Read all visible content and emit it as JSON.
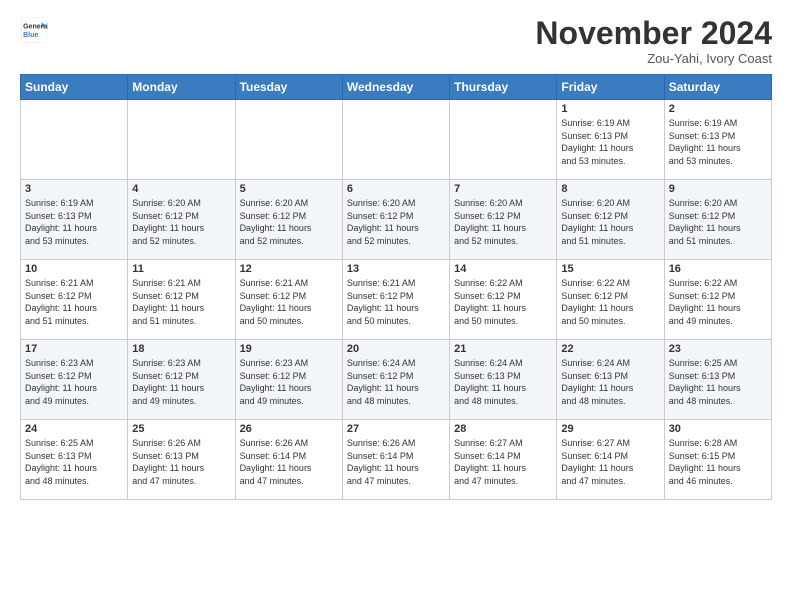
{
  "logo": {
    "line1": "General",
    "line2": "Blue"
  },
  "title": "November 2024",
  "location": "Zou-Yahi, Ivory Coast",
  "weekdays": [
    "Sunday",
    "Monday",
    "Tuesday",
    "Wednesday",
    "Thursday",
    "Friday",
    "Saturday"
  ],
  "weeks": [
    [
      {
        "day": "",
        "info": ""
      },
      {
        "day": "",
        "info": ""
      },
      {
        "day": "",
        "info": ""
      },
      {
        "day": "",
        "info": ""
      },
      {
        "day": "",
        "info": ""
      },
      {
        "day": "1",
        "info": "Sunrise: 6:19 AM\nSunset: 6:13 PM\nDaylight: 11 hours\nand 53 minutes."
      },
      {
        "day": "2",
        "info": "Sunrise: 6:19 AM\nSunset: 6:13 PM\nDaylight: 11 hours\nand 53 minutes."
      }
    ],
    [
      {
        "day": "3",
        "info": "Sunrise: 6:19 AM\nSunset: 6:13 PM\nDaylight: 11 hours\nand 53 minutes."
      },
      {
        "day": "4",
        "info": "Sunrise: 6:20 AM\nSunset: 6:12 PM\nDaylight: 11 hours\nand 52 minutes."
      },
      {
        "day": "5",
        "info": "Sunrise: 6:20 AM\nSunset: 6:12 PM\nDaylight: 11 hours\nand 52 minutes."
      },
      {
        "day": "6",
        "info": "Sunrise: 6:20 AM\nSunset: 6:12 PM\nDaylight: 11 hours\nand 52 minutes."
      },
      {
        "day": "7",
        "info": "Sunrise: 6:20 AM\nSunset: 6:12 PM\nDaylight: 11 hours\nand 52 minutes."
      },
      {
        "day": "8",
        "info": "Sunrise: 6:20 AM\nSunset: 6:12 PM\nDaylight: 11 hours\nand 51 minutes."
      },
      {
        "day": "9",
        "info": "Sunrise: 6:20 AM\nSunset: 6:12 PM\nDaylight: 11 hours\nand 51 minutes."
      }
    ],
    [
      {
        "day": "10",
        "info": "Sunrise: 6:21 AM\nSunset: 6:12 PM\nDaylight: 11 hours\nand 51 minutes."
      },
      {
        "day": "11",
        "info": "Sunrise: 6:21 AM\nSunset: 6:12 PM\nDaylight: 11 hours\nand 51 minutes."
      },
      {
        "day": "12",
        "info": "Sunrise: 6:21 AM\nSunset: 6:12 PM\nDaylight: 11 hours\nand 50 minutes."
      },
      {
        "day": "13",
        "info": "Sunrise: 6:21 AM\nSunset: 6:12 PM\nDaylight: 11 hours\nand 50 minutes."
      },
      {
        "day": "14",
        "info": "Sunrise: 6:22 AM\nSunset: 6:12 PM\nDaylight: 11 hours\nand 50 minutes."
      },
      {
        "day": "15",
        "info": "Sunrise: 6:22 AM\nSunset: 6:12 PM\nDaylight: 11 hours\nand 50 minutes."
      },
      {
        "day": "16",
        "info": "Sunrise: 6:22 AM\nSunset: 6:12 PM\nDaylight: 11 hours\nand 49 minutes."
      }
    ],
    [
      {
        "day": "17",
        "info": "Sunrise: 6:23 AM\nSunset: 6:12 PM\nDaylight: 11 hours\nand 49 minutes."
      },
      {
        "day": "18",
        "info": "Sunrise: 6:23 AM\nSunset: 6:12 PM\nDaylight: 11 hours\nand 49 minutes."
      },
      {
        "day": "19",
        "info": "Sunrise: 6:23 AM\nSunset: 6:12 PM\nDaylight: 11 hours\nand 49 minutes."
      },
      {
        "day": "20",
        "info": "Sunrise: 6:24 AM\nSunset: 6:12 PM\nDaylight: 11 hours\nand 48 minutes."
      },
      {
        "day": "21",
        "info": "Sunrise: 6:24 AM\nSunset: 6:13 PM\nDaylight: 11 hours\nand 48 minutes."
      },
      {
        "day": "22",
        "info": "Sunrise: 6:24 AM\nSunset: 6:13 PM\nDaylight: 11 hours\nand 48 minutes."
      },
      {
        "day": "23",
        "info": "Sunrise: 6:25 AM\nSunset: 6:13 PM\nDaylight: 11 hours\nand 48 minutes."
      }
    ],
    [
      {
        "day": "24",
        "info": "Sunrise: 6:25 AM\nSunset: 6:13 PM\nDaylight: 11 hours\nand 48 minutes."
      },
      {
        "day": "25",
        "info": "Sunrise: 6:26 AM\nSunset: 6:13 PM\nDaylight: 11 hours\nand 47 minutes."
      },
      {
        "day": "26",
        "info": "Sunrise: 6:26 AM\nSunset: 6:14 PM\nDaylight: 11 hours\nand 47 minutes."
      },
      {
        "day": "27",
        "info": "Sunrise: 6:26 AM\nSunset: 6:14 PM\nDaylight: 11 hours\nand 47 minutes."
      },
      {
        "day": "28",
        "info": "Sunrise: 6:27 AM\nSunset: 6:14 PM\nDaylight: 11 hours\nand 47 minutes."
      },
      {
        "day": "29",
        "info": "Sunrise: 6:27 AM\nSunset: 6:14 PM\nDaylight: 11 hours\nand 47 minutes."
      },
      {
        "day": "30",
        "info": "Sunrise: 6:28 AM\nSunset: 6:15 PM\nDaylight: 11 hours\nand 46 minutes."
      }
    ]
  ]
}
